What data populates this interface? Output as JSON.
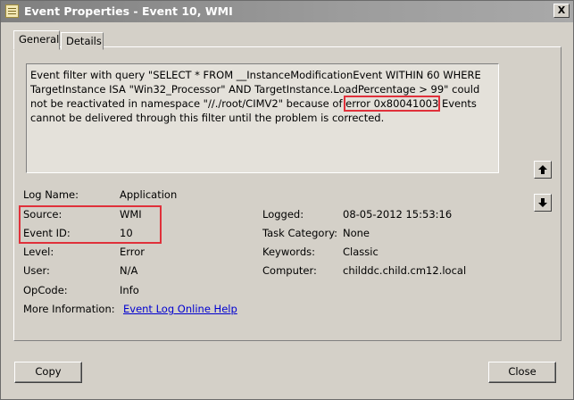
{
  "window": {
    "title": "Event Properties - Event 10, WMI",
    "close_label": "X"
  },
  "tabs": [
    {
      "label": "General"
    },
    {
      "label": "Details"
    }
  ],
  "description": {
    "before": "Event filter with query \"SELECT * FROM __InstanceModificationEvent WITHIN 60 WHERE TargetInstance ISA \"Win32_Processor\" AND TargetInstance.LoadPercentage > 99\" could not be reactivated in namespace \"//./root/CIMV2\" because of ",
    "error": "error 0x80041003",
    "after": " Events cannot be delivered through this filter until the problem is corrected."
  },
  "fields": {
    "log_name": {
      "label": "Log Name:",
      "value": "Application"
    },
    "source": {
      "label": "Source:",
      "value": "WMI"
    },
    "event_id": {
      "label": "Event ID:",
      "value": "10"
    },
    "level": {
      "label": "Level:",
      "value": "Error"
    },
    "user": {
      "label": "User:",
      "value": "N/A"
    },
    "opcode": {
      "label": "OpCode:",
      "value": "Info"
    },
    "more_info": {
      "label": "More Information:",
      "value": "Event Log Online Help"
    },
    "logged": {
      "label": "Logged:",
      "value": "08-05-2012 15:53:16"
    },
    "task_category": {
      "label": "Task Category:",
      "value": "None"
    },
    "keywords": {
      "label": "Keywords:",
      "value": "Classic"
    },
    "computer": {
      "label": "Computer:",
      "value": "childdc.child.cm12.local"
    }
  },
  "buttons": {
    "copy": "Copy",
    "close": "Close"
  },
  "colors": {
    "highlight": "#e0303a",
    "link": "#0000d0",
    "dialog": "#d4d0c8"
  }
}
